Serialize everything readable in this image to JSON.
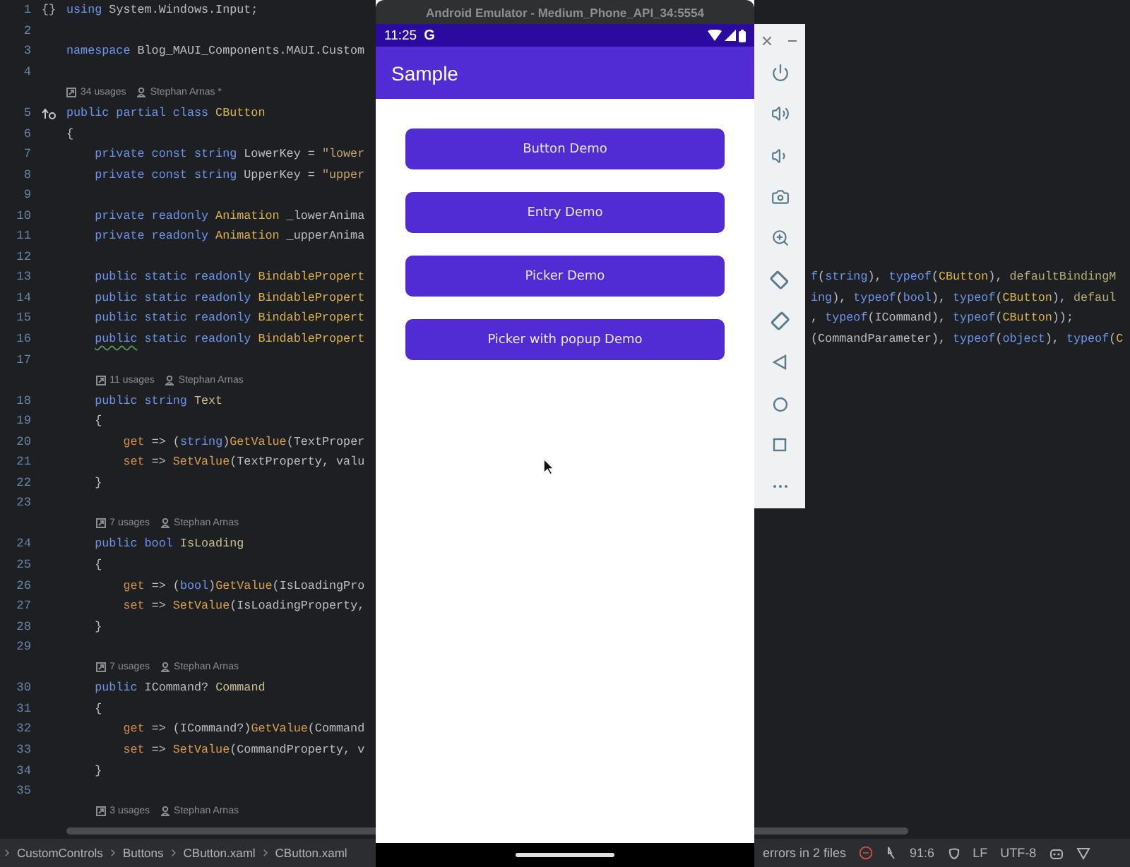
{
  "editor": {
    "lines": [
      {
        "kind": "code",
        "number": "1",
        "gutter": "{}",
        "left": [
          {
            "text": "using",
            "kind": "keyword"
          },
          {
            "text": " System.Windows.Input;",
            "kind": "plain"
          }
        ]
      },
      {
        "kind": "code",
        "number": "2"
      },
      {
        "kind": "code",
        "number": "3",
        "left": [
          {
            "text": "namespace",
            "kind": "keyword"
          },
          {
            "text": " Blog_MAUI_Components.MAUI.Custom",
            "kind": "plain"
          }
        ]
      },
      {
        "kind": "code",
        "number": "4"
      },
      {
        "kind": "annotation",
        "usages": "34 usages",
        "author": "Stephan Arnas *"
      },
      {
        "kind": "code",
        "number": "5",
        "implemented": true,
        "left": [
          {
            "text": "public partial class ",
            "kind": "keyword"
          },
          {
            "text": "CButton",
            "kind": "type"
          }
        ]
      },
      {
        "kind": "code",
        "number": "6",
        "left": [
          {
            "text": "{",
            "kind": "plain"
          }
        ]
      },
      {
        "kind": "code",
        "number": "7",
        "left": [
          {
            "text": "    private const string ",
            "kind": "keyword"
          },
          {
            "text": "LowerKey = ",
            "kind": "plain"
          },
          {
            "text": "\"lower",
            "kind": "string"
          }
        ]
      },
      {
        "kind": "code",
        "number": "8",
        "left": [
          {
            "text": "    private const string ",
            "kind": "keyword"
          },
          {
            "text": "UpperKey = ",
            "kind": "plain"
          },
          {
            "text": "\"upper",
            "kind": "string"
          }
        ]
      },
      {
        "kind": "code",
        "number": "9"
      },
      {
        "kind": "code",
        "number": "10",
        "left": [
          {
            "text": "    private readonly ",
            "kind": "keyword"
          },
          {
            "text": "Animation",
            "kind": "type"
          },
          {
            "text": " _lowerAnima",
            "kind": "plain"
          }
        ]
      },
      {
        "kind": "code",
        "number": "11",
        "left": [
          {
            "text": "    private readonly ",
            "kind": "keyword"
          },
          {
            "text": "Animation",
            "kind": "type"
          },
          {
            "text": " _upperAnima",
            "kind": "plain"
          }
        ]
      },
      {
        "kind": "code",
        "number": "12"
      },
      {
        "kind": "code",
        "number": "13",
        "left": [
          {
            "text": "    public static readonly ",
            "kind": "keyword"
          },
          {
            "text": "BindablePropert",
            "kind": "type"
          }
        ],
        "right": [
          {
            "text": "f",
            "kind": "keyword"
          },
          {
            "text": "(",
            "kind": "plain"
          },
          {
            "text": "string",
            "kind": "keyword"
          },
          {
            "text": "), ",
            "kind": "plain"
          },
          {
            "text": "typeof",
            "kind": "keyword"
          },
          {
            "text": "(",
            "kind": "plain"
          },
          {
            "text": "CButton",
            "kind": "type"
          },
          {
            "text": "), ",
            "kind": "plain"
          },
          {
            "text": "defaultBindingM",
            "kind": "param"
          }
        ]
      },
      {
        "kind": "code",
        "number": "14",
        "left": [
          {
            "text": "    public static readonly ",
            "kind": "keyword"
          },
          {
            "text": "BindablePropert",
            "kind": "type"
          }
        ],
        "right": [
          {
            "text": "ing",
            "kind": "keyword"
          },
          {
            "text": "), ",
            "kind": "plain"
          },
          {
            "text": "typeof",
            "kind": "keyword"
          },
          {
            "text": "(",
            "kind": "plain"
          },
          {
            "text": "bool",
            "kind": "keyword"
          },
          {
            "text": "), ",
            "kind": "plain"
          },
          {
            "text": "typeof",
            "kind": "keyword"
          },
          {
            "text": "(",
            "kind": "plain"
          },
          {
            "text": "CButton",
            "kind": "type"
          },
          {
            "text": "), ",
            "kind": "plain"
          },
          {
            "text": "defaul",
            "kind": "param"
          }
        ]
      },
      {
        "kind": "code",
        "number": "15",
        "left": [
          {
            "text": "    public static readonly ",
            "kind": "keyword"
          },
          {
            "text": "BindablePropert",
            "kind": "type"
          }
        ],
        "right": [
          {
            "text": ", ",
            "kind": "plain"
          },
          {
            "text": "typeof",
            "kind": "keyword"
          },
          {
            "text": "(ICommand), ",
            "kind": "plain"
          },
          {
            "text": "typeof",
            "kind": "keyword"
          },
          {
            "text": "(",
            "kind": "plain"
          },
          {
            "text": "CButton",
            "kind": "type"
          },
          {
            "text": "));",
            "kind": "plain"
          }
        ]
      },
      {
        "kind": "code",
        "number": "16",
        "left": [
          {
            "text": "    public",
            "kind": "keyword",
            "warning": true
          },
          {
            "text": " static readonly ",
            "kind": "keyword"
          },
          {
            "text": "BindablePropert",
            "kind": "type"
          }
        ],
        "right": [
          {
            "text": "(CommandParameter), ",
            "kind": "plain"
          },
          {
            "text": "typeof",
            "kind": "keyword"
          },
          {
            "text": "(",
            "kind": "plain"
          },
          {
            "text": "object",
            "kind": "keyword"
          },
          {
            "text": "), ",
            "kind": "plain"
          },
          {
            "text": "typeof",
            "kind": "keyword"
          },
          {
            "text": "(",
            "kind": "plain"
          },
          {
            "text": "C",
            "kind": "type"
          }
        ]
      },
      {
        "kind": "code",
        "number": "17"
      },
      {
        "kind": "annotation",
        "usages": "11 usages",
        "author": "Stephan Arnas"
      },
      {
        "kind": "code",
        "number": "18",
        "left": [
          {
            "text": "    public string ",
            "kind": "keyword"
          },
          {
            "text": "Text",
            "kind": "member"
          }
        ]
      },
      {
        "kind": "code",
        "number": "19",
        "left": [
          {
            "text": "    {",
            "kind": "plain"
          }
        ]
      },
      {
        "kind": "code",
        "number": "20",
        "left": [
          {
            "text": "        get",
            "kind": "accessor"
          },
          {
            "text": " => (",
            "kind": "plain"
          },
          {
            "text": "string",
            "kind": "keyword"
          },
          {
            "text": ")",
            "kind": "plain"
          },
          {
            "text": "GetValue",
            "kind": "method"
          },
          {
            "text": "(TextProper",
            "kind": "plain"
          }
        ]
      },
      {
        "kind": "code",
        "number": "21",
        "left": [
          {
            "text": "        set",
            "kind": "accessor"
          },
          {
            "text": " => ",
            "kind": "plain"
          },
          {
            "text": "SetValue",
            "kind": "method"
          },
          {
            "text": "(TextProperty, valu",
            "kind": "plain"
          }
        ]
      },
      {
        "kind": "code",
        "number": "22",
        "left": [
          {
            "text": "    }",
            "kind": "plain"
          }
        ]
      },
      {
        "kind": "code",
        "number": "23"
      },
      {
        "kind": "annotation",
        "usages": "7 usages",
        "author": "Stephan Arnas"
      },
      {
        "kind": "code",
        "number": "24",
        "left": [
          {
            "text": "    public bool ",
            "kind": "keyword"
          },
          {
            "text": "IsLoading",
            "kind": "member"
          }
        ]
      },
      {
        "kind": "code",
        "number": "25",
        "left": [
          {
            "text": "    {",
            "kind": "plain"
          }
        ]
      },
      {
        "kind": "code",
        "number": "26",
        "left": [
          {
            "text": "        get",
            "kind": "accessor"
          },
          {
            "text": " => (",
            "kind": "plain"
          },
          {
            "text": "bool",
            "kind": "keyword"
          },
          {
            "text": ")",
            "kind": "plain"
          },
          {
            "text": "GetValue",
            "kind": "method"
          },
          {
            "text": "(IsLoadingPro",
            "kind": "plain"
          }
        ]
      },
      {
        "kind": "code",
        "number": "27",
        "left": [
          {
            "text": "        set",
            "kind": "accessor"
          },
          {
            "text": " => ",
            "kind": "plain"
          },
          {
            "text": "SetValue",
            "kind": "method"
          },
          {
            "text": "(IsLoadingProperty,",
            "kind": "plain"
          }
        ]
      },
      {
        "kind": "code",
        "number": "28",
        "left": [
          {
            "text": "    }",
            "kind": "plain"
          }
        ]
      },
      {
        "kind": "code",
        "number": "29"
      },
      {
        "kind": "annotation",
        "usages": "7 usages",
        "author": "Stephan Arnas"
      },
      {
        "kind": "code",
        "number": "30",
        "left": [
          {
            "text": "    public ",
            "kind": "keyword"
          },
          {
            "text": "ICommand? ",
            "kind": "plain"
          },
          {
            "text": "Command",
            "kind": "member"
          }
        ]
      },
      {
        "kind": "code",
        "number": "31",
        "left": [
          {
            "text": "    {",
            "kind": "plain"
          }
        ]
      },
      {
        "kind": "code",
        "number": "32",
        "left": [
          {
            "text": "        get",
            "kind": "accessor"
          },
          {
            "text": " => (ICommand?)",
            "kind": "plain"
          },
          {
            "text": "GetValue",
            "kind": "method"
          },
          {
            "text": "(Command",
            "kind": "plain"
          }
        ]
      },
      {
        "kind": "code",
        "number": "33",
        "left": [
          {
            "text": "        set",
            "kind": "accessor"
          },
          {
            "text": " => ",
            "kind": "plain"
          },
          {
            "text": "SetValue",
            "kind": "method"
          },
          {
            "text": "(CommandProperty, v",
            "kind": "plain"
          }
        ]
      },
      {
        "kind": "code",
        "number": "34",
        "left": [
          {
            "text": "    }",
            "kind": "plain"
          }
        ]
      },
      {
        "kind": "code",
        "number": "35"
      },
      {
        "kind": "annotation",
        "usages": "3 usages",
        "author": "Stephan Arnas"
      }
    ]
  },
  "emulator": {
    "title": "Android Emulator - Medium_Phone_API_34:5554",
    "time": "11:25",
    "notification": "G",
    "app_title": "Sample",
    "buttons": [
      "Button Demo",
      "Entry Demo",
      "Picker Demo",
      "Picker with popup Demo"
    ]
  },
  "status_bar": {
    "breadcrumb": [
      "CustomControls",
      "Buttons",
      "CButton.xaml",
      "CButton.xaml"
    ],
    "problems": "errors in 2 files",
    "position": "91:6",
    "line_ending": "LF",
    "encoding": "UTF-8"
  }
}
